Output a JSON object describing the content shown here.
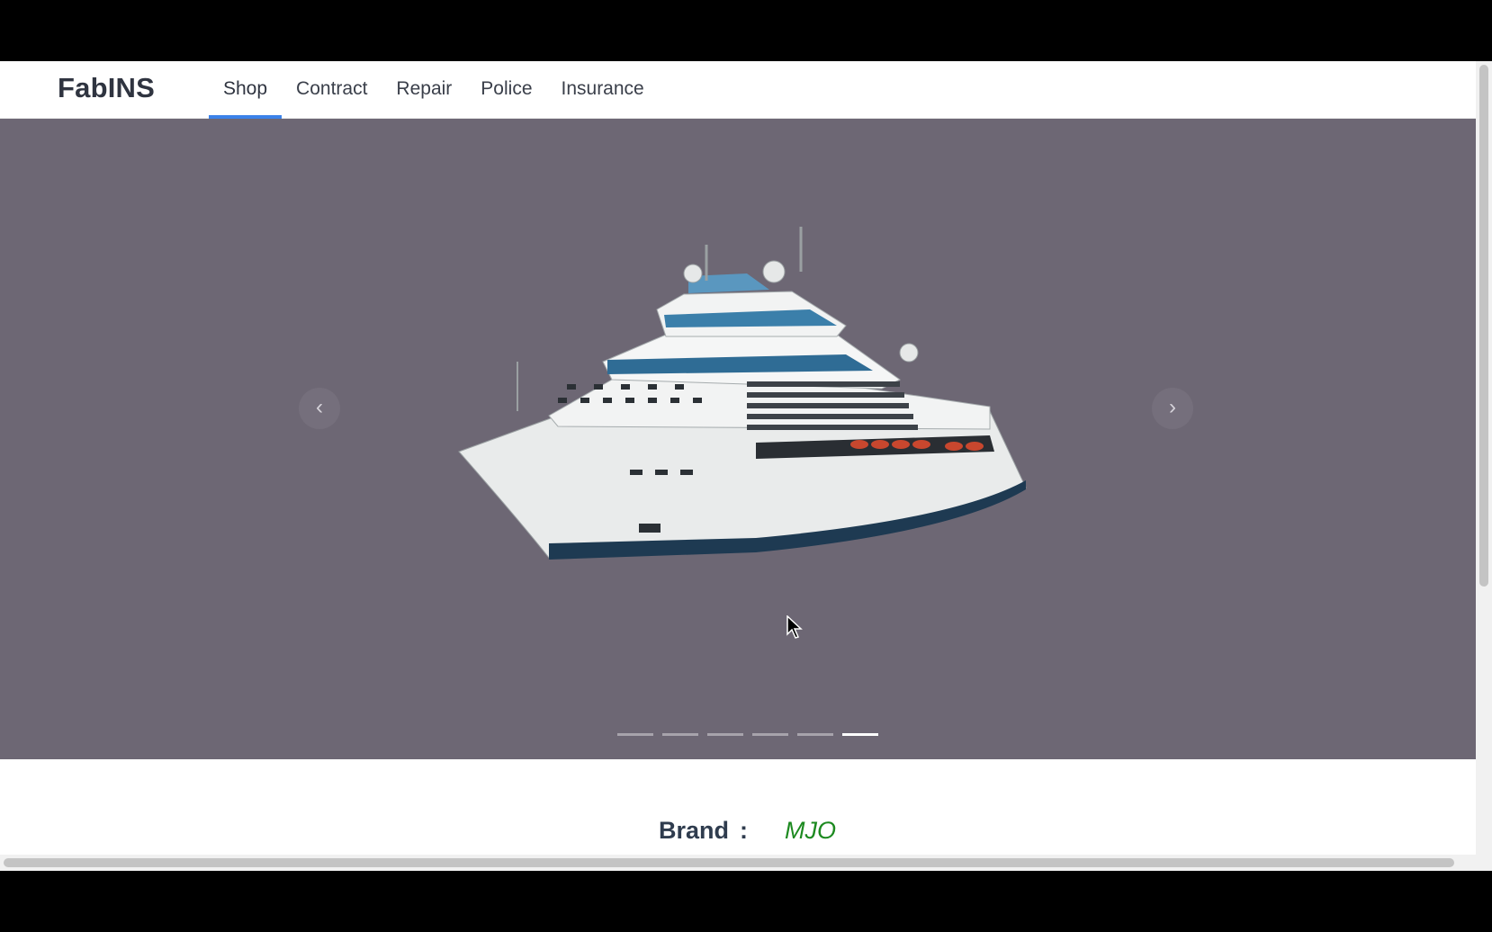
{
  "app": {
    "logo": "FabINS"
  },
  "nav": {
    "items": [
      {
        "label": "Shop",
        "active": true
      },
      {
        "label": "Contract",
        "active": false
      },
      {
        "label": "Repair",
        "active": false
      },
      {
        "label": "Police",
        "active": false
      },
      {
        "label": "Insurance",
        "active": false
      }
    ]
  },
  "carousel": {
    "prev_icon": "‹",
    "next_icon": "›",
    "slide_count": 6,
    "active_index": 5,
    "image_subject": "cruise-ship"
  },
  "details": {
    "brand_label": "Brand",
    "separator": ":",
    "brand_value": "MJO"
  },
  "colors": {
    "accent": "#3b82e9",
    "carousel_bg": "#6d6774",
    "value_green": "#1d8a20"
  }
}
